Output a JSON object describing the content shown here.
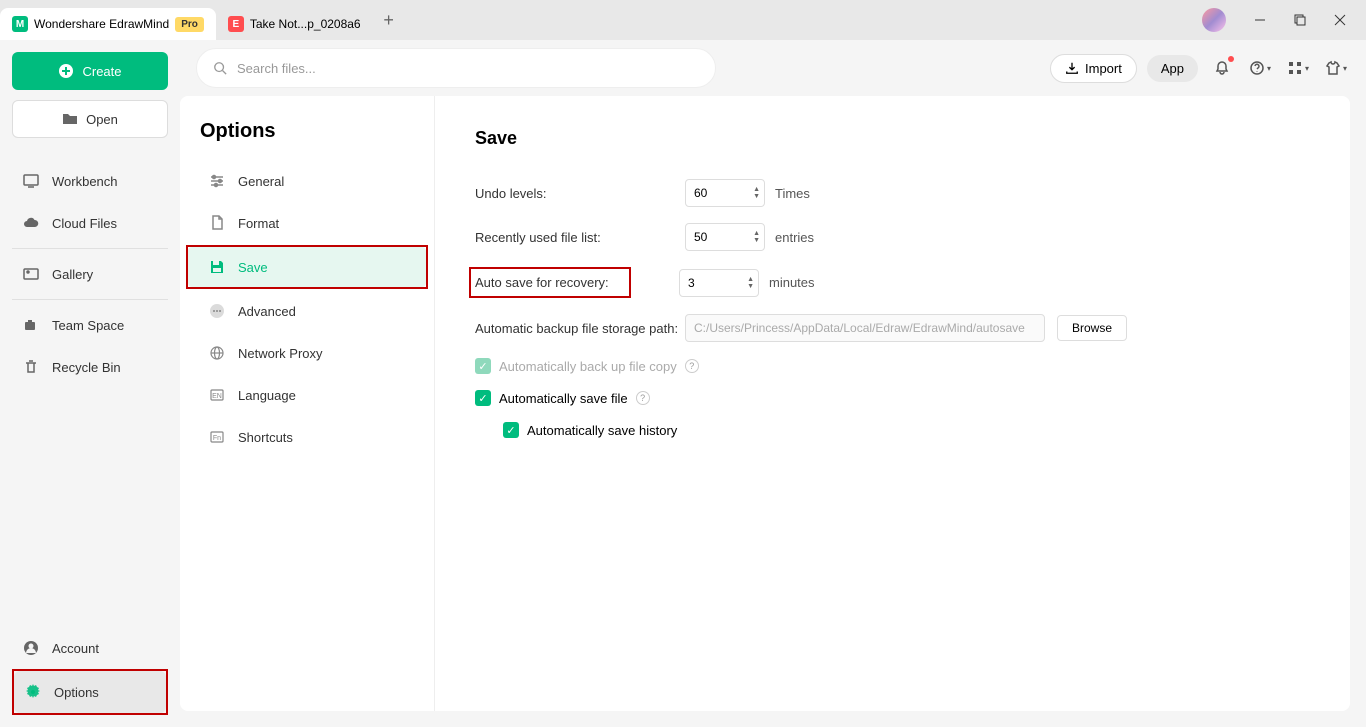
{
  "titlebar": {
    "tab1_label": "Wondershare EdrawMind",
    "tab1_badge": "Pro",
    "tab2_label": "Take Not...p_0208a6"
  },
  "sidebar": {
    "create": "Create",
    "open": "Open",
    "workbench": "Workbench",
    "cloud": "Cloud Files",
    "gallery": "Gallery",
    "team": "Team Space",
    "recycle": "Recycle Bin",
    "account": "Account",
    "options": "Options"
  },
  "search": {
    "placeholder": "Search files..."
  },
  "top": {
    "import": "Import",
    "app": "App"
  },
  "options_nav": {
    "title": "Options",
    "general": "General",
    "format": "Format",
    "save": "Save",
    "advanced": "Advanced",
    "network": "Network Proxy",
    "language": "Language",
    "shortcuts": "Shortcuts"
  },
  "save": {
    "heading": "Save",
    "undo_label": "Undo levels:",
    "undo_value": "60",
    "undo_unit": "Times",
    "recent_label": "Recently used file list:",
    "recent_value": "50",
    "recent_unit": "entries",
    "autosave_label": "Auto save for recovery:",
    "autosave_value": "3",
    "autosave_unit": "minutes",
    "backup_label": "Automatic backup file storage path:",
    "backup_path": "C:/Users/Princess/AppData/Local/Edraw/EdrawMind/autosave",
    "browse": "Browse",
    "check_backup": "Automatically back up file copy",
    "check_savefile": "Automatically save file",
    "check_history": "Automatically save history"
  }
}
